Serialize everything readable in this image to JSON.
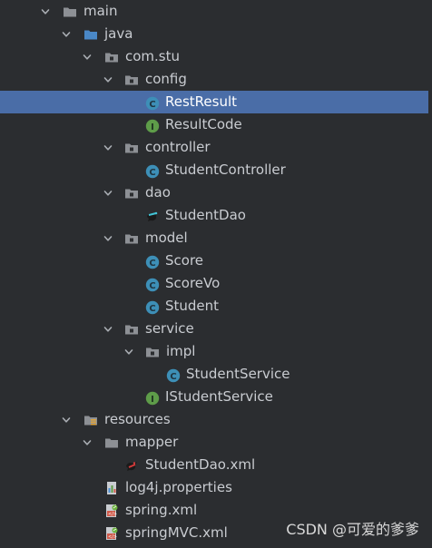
{
  "tree": {
    "main": "main",
    "java": "java",
    "com_stu": "com.stu",
    "config": "config",
    "rest_result": "RestResult",
    "result_code": "ResultCode",
    "controller": "controller",
    "student_controller": "StudentController",
    "dao": "dao",
    "student_dao": "StudentDao",
    "model": "model",
    "score": "Score",
    "score_vo": "ScoreVo",
    "student": "Student",
    "service": "service",
    "impl": "impl",
    "student_service": "StudentService",
    "istudent_service": "IStudentService",
    "resources": "resources",
    "mapper": "mapper",
    "student_dao_xml": "StudentDao.xml",
    "log4j": "log4j.properties",
    "spring_xml": "spring.xml",
    "spring_mvc_xml": "springMVC.xml"
  },
  "icons": {
    "class_badge": "C",
    "interface_badge": "I"
  },
  "watermark": "CSDN @可爱的爹爹",
  "colors": {
    "background": "#2b2d30",
    "selection": "#4a6da7",
    "folder": "#8d9095",
    "source_folder": "#4a88c7",
    "class_icon": "#3d8fb7",
    "interface_icon": "#5e9c49"
  }
}
